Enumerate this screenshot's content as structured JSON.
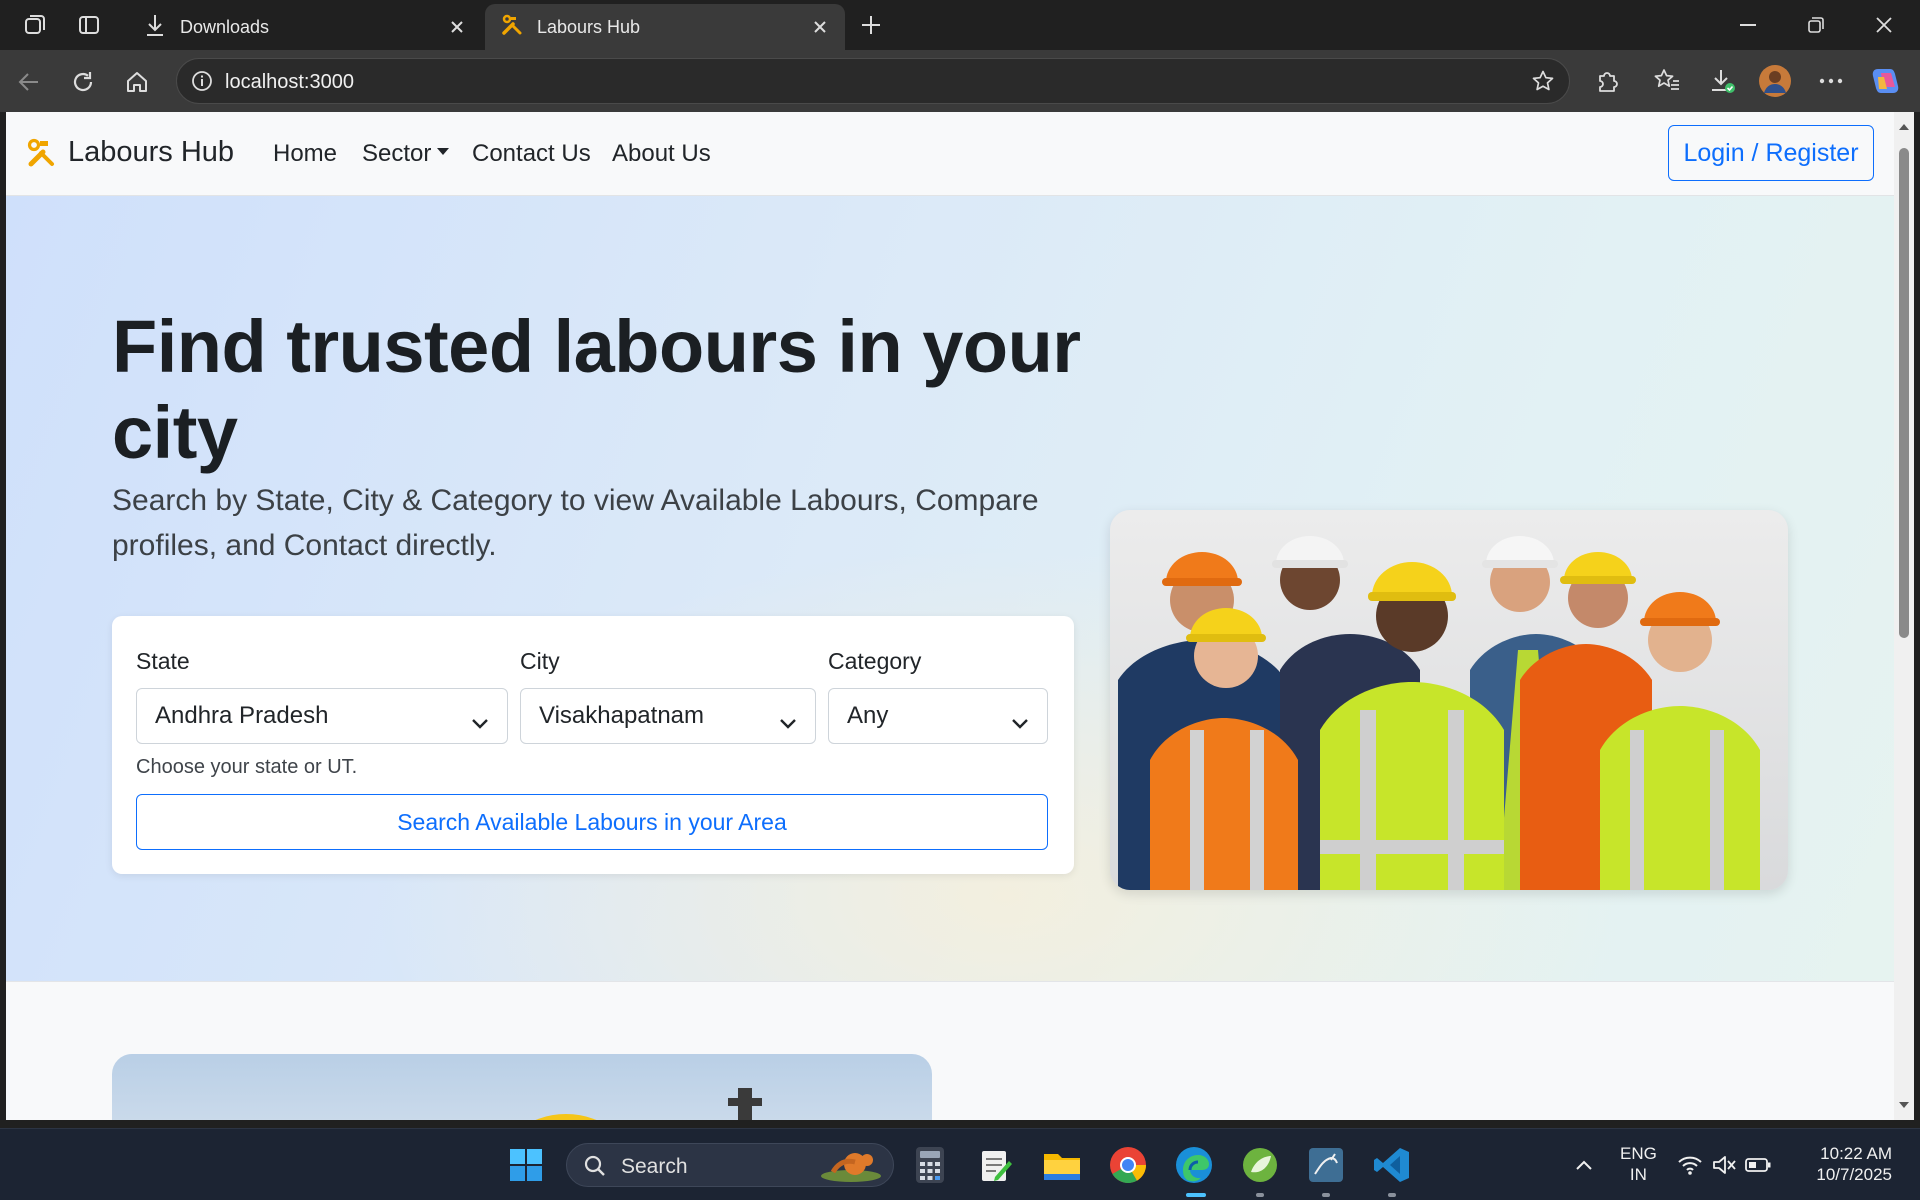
{
  "browser": {
    "tabs": [
      {
        "label": "Downloads"
      },
      {
        "label": "Labours Hub"
      }
    ],
    "url": "localhost:3000"
  },
  "navbar": {
    "brand": "Labours Hub",
    "links": [
      "Home",
      "Sector",
      "Contact Us",
      "About Us"
    ],
    "login_label": "Login / Register"
  },
  "hero": {
    "title": "Find trusted labours in your city",
    "subtitle": "Search by State, City & Category to view Available Labours, Compare profiles, and Contact directly.",
    "form": {
      "state_label": "State",
      "state_value": "Andhra Pradesh",
      "city_label": "City",
      "city_value": "Visakhapatnam",
      "category_label": "Category",
      "category_value": "Any",
      "help_text": "Choose your state or UT.",
      "search_button": "Search Available Labours in your Area"
    }
  },
  "taskbar": {
    "search_label": "Search",
    "lang_line1": "ENG",
    "lang_line2": "IN",
    "time": "10:22 AM",
    "date": "10/7/2025"
  },
  "colors": {
    "primary": "#0d6efd",
    "brand_icon": "#f0a500",
    "chrome_dark": "#202020",
    "taskbar": "#1c2433"
  },
  "icons": [
    "workspaces-icon",
    "tab-actions-icon",
    "download-icon",
    "close-icon",
    "hammer-wrench-icon",
    "new-tab-icon",
    "minimize-icon",
    "restore-icon",
    "back-icon",
    "refresh-icon",
    "home-icon",
    "info-icon",
    "star-icon",
    "extensions-icon",
    "favorites-icon",
    "downloads-icon",
    "profile-icon",
    "more-icon",
    "copilot-icon",
    "windows-start-icon",
    "search-icon",
    "calculator-icon",
    "notepad-icon",
    "file-explorer-icon",
    "chrome-icon",
    "edge-icon",
    "spring-icon",
    "mysql-icon",
    "vscode-icon",
    "chevron-up-icon",
    "wifi-icon",
    "mute-icon",
    "battery-icon"
  ]
}
